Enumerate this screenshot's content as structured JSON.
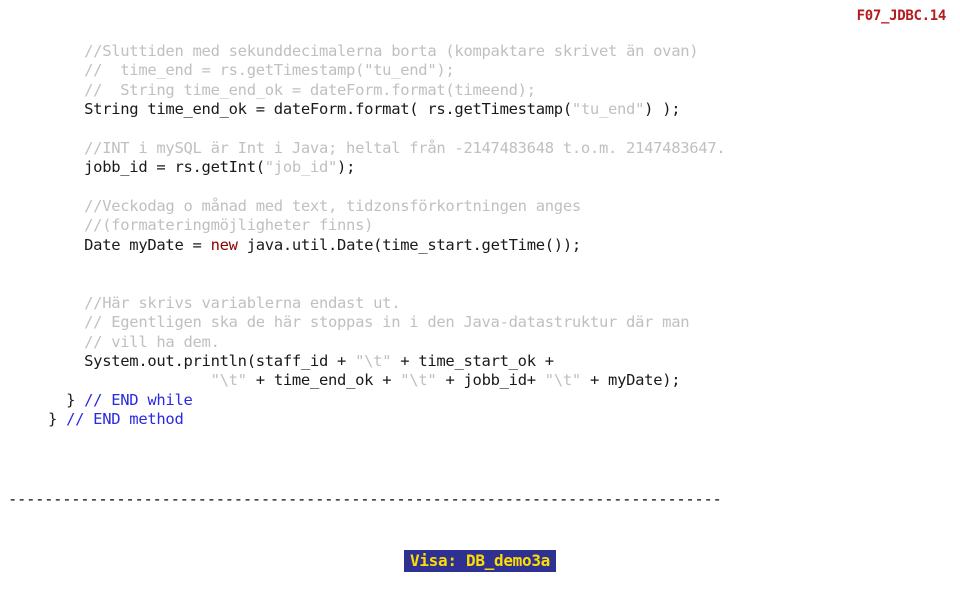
{
  "header": {
    "label": "F07_JDBC.14"
  },
  "code": {
    "l1": "    //Sluttiden med sekunddecimalerna borta (kompaktare skrivet än ovan)",
    "l2": "    //  time_end = rs.getTimestamp(\"tu_end\");",
    "l3": "    //  String time_end_ok = dateForm.format(timeend);",
    "l4a": "    String time_end_ok = dateForm.format( rs.getTimestamp(",
    "l4b": "\"tu_end\"",
    "l4c": ") );",
    "l5": "",
    "l6": "    //INT i mySQL är Int i Java; heltal från -2147483648 t.o.m. 2147483647.",
    "l7a": "    jobb_id = rs.getInt(",
    "l7b": "\"job_id\"",
    "l7c": ");",
    "l8": "",
    "l9": "    //Veckodag o månad med text, tidzonsförkortningen anges",
    "l10": "    //(formateringmöjligheter finns)",
    "l11a": "    Date myDate = ",
    "l11b": "new",
    "l11c": " java.util.Date(time_start.getTime());",
    "l12": "",
    "l13": "",
    "l14": "    //Här skrivs variablerna endast ut.",
    "l15": "    // Egentligen ska de här stoppas in i den Java-datastruktur där man",
    "l16": "    // vill ha dem.",
    "l17a": "    System.out.println(staff_id + ",
    "l17b": "\"\\t\"",
    "l17c": " + time_start_ok +",
    "l18a": "                  ",
    "l18b": "\"\\t\"",
    "l18c": " + time_end_ok + ",
    "l18d": "\"\\t\"",
    "l18e": " + jobb_id+ ",
    "l18f": "\"\\t\"",
    "l18g": " + myDate);",
    "l19a": "  } ",
    "l19b": "// END while",
    "l20a": "} ",
    "l20b": "// END method"
  },
  "divider": "-------------------------------------------------------------------------------",
  "visa": {
    "label": "Visa: DB_demo3a"
  }
}
